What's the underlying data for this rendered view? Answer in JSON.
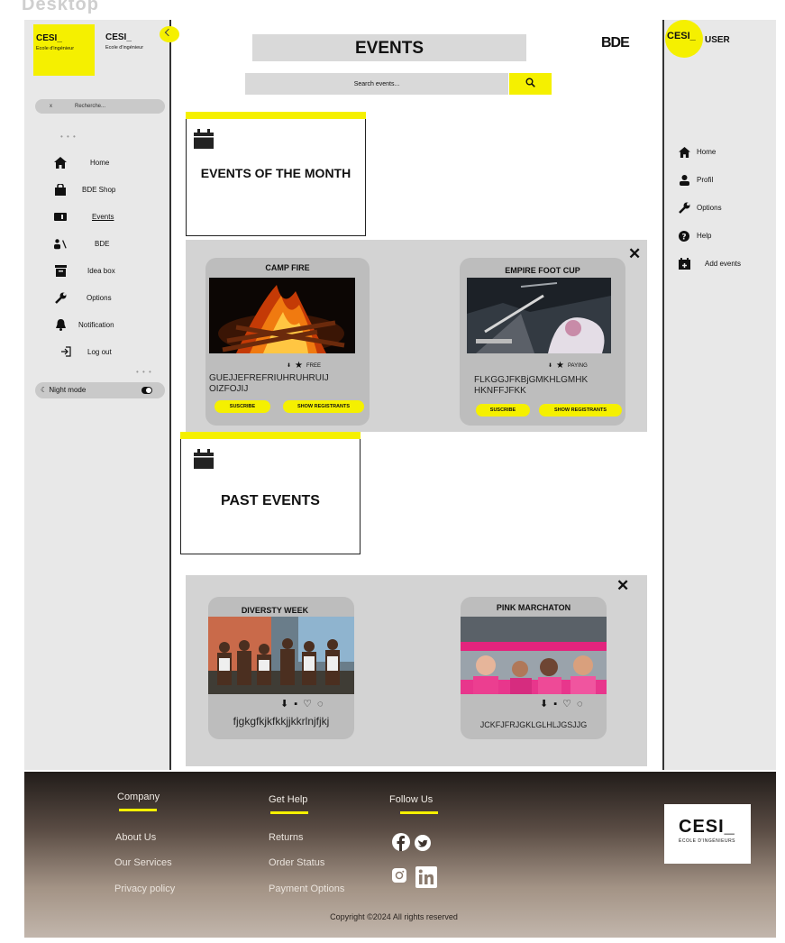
{
  "header": {
    "ghost_title": "Desktop",
    "main_title": "EVENTS",
    "bde_logo": "BDE",
    "search_placeholder": "Search events..."
  },
  "left_sidebar": {
    "logo_main": "CESI_",
    "logo_sub": "Ecole d'ingénieur",
    "search_label": "Recherche...",
    "search_close": "x",
    "items": [
      {
        "label": "Home",
        "icon": "home-icon"
      },
      {
        "label": "BDE Shop",
        "icon": "shop-bag-icon"
      },
      {
        "label": "Events",
        "icon": "ticket-icon"
      },
      {
        "label": "BDE",
        "icon": "group-icon"
      },
      {
        "label": "Idea box",
        "icon": "archive-box-icon"
      },
      {
        "label": "Options",
        "icon": "wrench-icon"
      },
      {
        "label": "Notification",
        "icon": "bell-icon"
      },
      {
        "label": "Log out",
        "icon": "logout-icon"
      }
    ],
    "night_mode": "Night mode"
  },
  "right_sidebar": {
    "logo": "CESI_",
    "user": "USER",
    "items": [
      {
        "label": "Home",
        "icon": "home-icon"
      },
      {
        "label": "Profil",
        "icon": "person-icon"
      },
      {
        "label": "Options",
        "icon": "wrench-icon"
      },
      {
        "label": "Help",
        "icon": "help-icon"
      },
      {
        "label": "Add events",
        "icon": "calendar-add-icon"
      }
    ]
  },
  "sections": {
    "month": "EVENTS OF THE MONTH",
    "past": "PAST EVENTS"
  },
  "month_events": [
    {
      "name": "CAMP FIRE",
      "price": "FREE",
      "desc": "GUEJJEFREFRIUHRUHRUIJ OIZFOJIJ",
      "subscribe": "SUSCRIBE",
      "show": "SHOW REGISTRANTS"
    },
    {
      "name": "EMPIRE FOOT CUP",
      "price": "PAYING",
      "desc": "FLKGGJFKBjGMKHLGMHK HKNFFJFKK",
      "subscribe": "SUSCRIBE",
      "show": "SHOW REGISTRANTS"
    }
  ],
  "past_events": [
    {
      "name": "DIVERSTY WEEK",
      "desc": "fjgkgfkjkfkkjjkkrlnjfjkj"
    },
    {
      "name": "PINK MARCHATON",
      "desc": "JCKFJFRJGKLGLHLJGSJJG"
    }
  ],
  "footer": {
    "company": {
      "title": "Company",
      "links": [
        "About Us",
        "Our Services",
        "Privacy policy"
      ]
    },
    "help": {
      "title": "Get Help",
      "links": [
        "Returns",
        "Order Status",
        "Payment Options"
      ]
    },
    "follow": {
      "title": "Follow Us"
    },
    "logo_main": "CESI_",
    "logo_sub": "ÉCOLE D'INGÉNIEURS",
    "copyright": "Copyright ©2024 All rights reserved"
  },
  "colors": {
    "accent": "#f5f000",
    "panel": "#d3d3d3",
    "sidebar": "#e8e8e8"
  }
}
